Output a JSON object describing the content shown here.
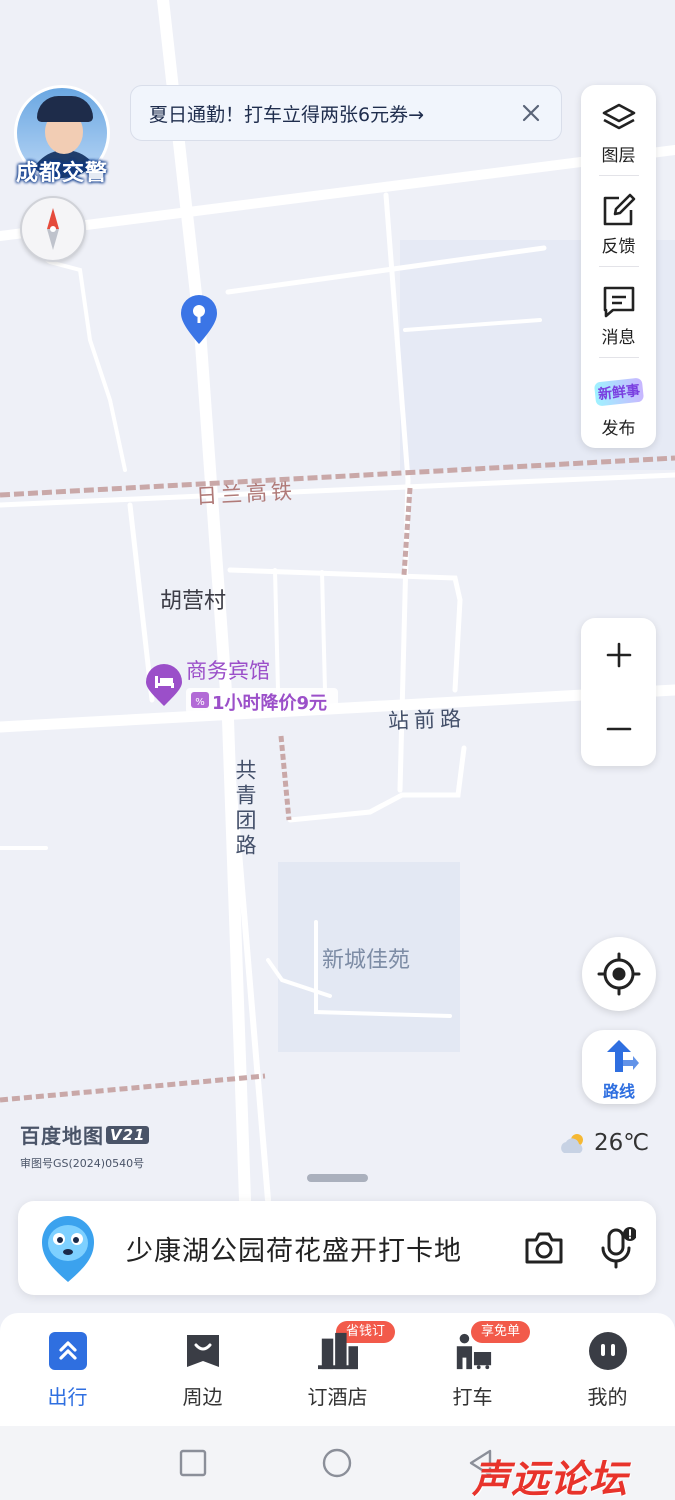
{
  "avatar": {
    "label": "成都交警"
  },
  "promo": {
    "text": "夏日通勤！打车立得两张6元券→"
  },
  "side_panel": {
    "items": [
      {
        "label": "图层",
        "icon": "layers-icon"
      },
      {
        "label": "反馈",
        "icon": "feedback-icon"
      },
      {
        "label": "消息",
        "icon": "message-icon"
      },
      {
        "label": "发布",
        "icon": "new-post-icon",
        "badge_text": "新鲜事"
      }
    ]
  },
  "map": {
    "labels": {
      "railway": "日兰高铁",
      "village": "胡营村",
      "hotel_name": "商务宾馆",
      "hotel_deal": "1小时降价9元",
      "road_east": "站前路",
      "road_main": "共青团路",
      "community": "新城佳苑"
    }
  },
  "route_button": {
    "label": "路线"
  },
  "brand": {
    "name": "百度地图",
    "version": "V21",
    "code": "审图号GS(2024)0540号"
  },
  "weather": {
    "temperature": "26℃",
    "icon": "partly-cloudy-icon"
  },
  "search": {
    "placeholder": "少康湖公园荷花盛开打卡地"
  },
  "tabs": [
    {
      "label": "出行",
      "icon": "travel-icon",
      "active": true
    },
    {
      "label": "周边",
      "icon": "nearby-icon",
      "active": false
    },
    {
      "label": "订酒店",
      "icon": "hotel-icon",
      "active": false,
      "badge": "省钱订"
    },
    {
      "label": "打车",
      "icon": "taxi-icon",
      "active": false,
      "badge": "享免单"
    },
    {
      "label": "我的",
      "icon": "profile-icon",
      "active": false
    }
  ],
  "watermark": {
    "text": "声远论坛"
  },
  "colors": {
    "accent": "#2f6fe0",
    "map_bg": "#eef0f7",
    "road": "#ffffff",
    "railway": "#c9a8a8",
    "hotel_purple": "#9b4fc9",
    "badge_red": "#f25a4a"
  }
}
